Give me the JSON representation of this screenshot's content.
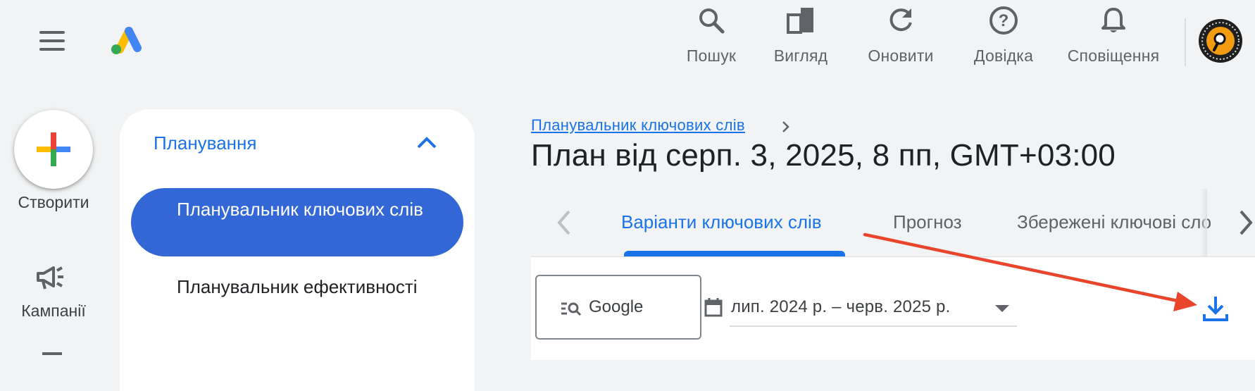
{
  "top_bar": {
    "actions": [
      {
        "label": "Пошук",
        "icon": "search-icon"
      },
      {
        "label": "Вигляд",
        "icon": "view-icon"
      },
      {
        "label": "Оновити",
        "icon": "refresh-icon"
      },
      {
        "label": "Довідка",
        "icon": "help-icon"
      },
      {
        "label": "Сповіщення",
        "icon": "notifications-icon"
      }
    ]
  },
  "left_rail": {
    "create_label": "Створити",
    "campaigns_label": "Кампанії"
  },
  "nav_panel": {
    "group_title": "Планування",
    "items": [
      {
        "label": "Планувальник ключових слів",
        "active": true
      },
      {
        "label": "Планувальник ефективності",
        "active": false
      }
    ]
  },
  "main": {
    "breadcrumb": "Планувальник ключових слів",
    "page_title": "План від серп. 3, 2025, 8 пп, GMT+03:00",
    "tabs": [
      {
        "label": "Варіанти ключових слів",
        "active": true
      },
      {
        "label": "Прогноз",
        "active": false
      },
      {
        "label": "Збережені ключові слова",
        "active": false
      }
    ],
    "network_button_label": "Google",
    "date_range": "лип. 2024 р. – черв. 2025 р."
  },
  "colors": {
    "accent_blue": "#1a73e8",
    "nav_active_bg": "#3367d6",
    "annotation_arrow": "#e8452c"
  }
}
